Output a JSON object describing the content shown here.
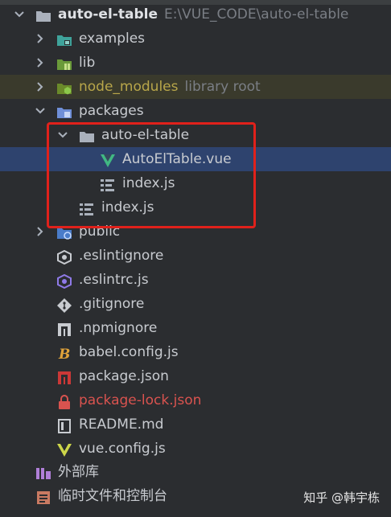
{
  "colors": {
    "background": "#2b2d30",
    "selection": "#2e436e",
    "highlight_box": "#e0211b",
    "folder": "#aab1bc",
    "vue_green": "#41b883"
  },
  "tree": {
    "root": {
      "name": "auto-el-table",
      "path": "E:\\VUE_CODE\\auto-el-table",
      "icon": "folder-icon"
    },
    "examples": {
      "name": "examples"
    },
    "lib": {
      "name": "lib"
    },
    "node_modules": {
      "name": "node_modules",
      "hint": "library root"
    },
    "packages": {
      "name": "packages"
    },
    "auto_el_table": {
      "name": "auto-el-table"
    },
    "auto_el_table_vue": {
      "name": "AutoElTable.vue"
    },
    "inner_index": {
      "name": "index.js"
    },
    "packages_index": {
      "name": "index.js"
    },
    "public": {
      "name": "public"
    },
    "files": [
      {
        "name": ".eslintignore",
        "icon": "eslint-icon"
      },
      {
        "name": ".eslintrc.js",
        "icon": "eslint-config-icon"
      },
      {
        "name": ".gitignore",
        "icon": "git-icon"
      },
      {
        "name": ".npmignore",
        "icon": "npm-icon"
      },
      {
        "name": "babel.config.js",
        "icon": "babel-icon"
      },
      {
        "name": "package.json",
        "icon": "npm-package-icon"
      },
      {
        "name": "package-lock.json",
        "icon": "lock-icon"
      },
      {
        "name": "README.md",
        "icon": "readme-icon"
      },
      {
        "name": "vue.config.js",
        "icon": "vue-icon"
      }
    ]
  },
  "bottom": {
    "external_libs": "外部库",
    "scratches": "临时文件和控制台"
  },
  "watermark": "知乎 @韩宇栋"
}
